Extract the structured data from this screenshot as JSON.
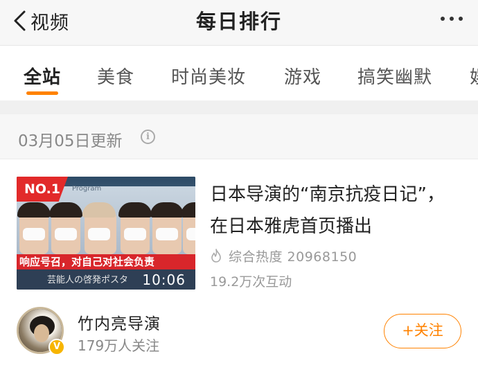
{
  "nav": {
    "back_label": "视频",
    "title": "每日排行"
  },
  "tabs": [
    {
      "label": "全站",
      "active": true
    },
    {
      "label": "美食",
      "active": false
    },
    {
      "label": "时尚美妆",
      "active": false
    },
    {
      "label": "游戏",
      "active": false
    },
    {
      "label": "搞笑幽默",
      "active": false
    },
    {
      "label": "娱",
      "active": false
    }
  ],
  "update": {
    "text": "03月05日更新",
    "info_icon": "info-icon"
  },
  "article": {
    "rank_badge": "NO.1",
    "headline": "日本导演的“南京抗疫日记”，在日本雅虎首页播出",
    "heat": "综合热度 20968150",
    "interactions": "19.2万次互动",
    "thumbnail": {
      "program_text": "Program",
      "banner_text": "响应号召，对自己对社会负责",
      "caption_text": "芸能人の啓発ポスタ",
      "duration": "10:06"
    }
  },
  "author": {
    "name": "竹内亮导演",
    "fans": "179万人关注",
    "verified_badge": "V",
    "follow_label": "+关注"
  },
  "colors": {
    "accent": "#ff8200",
    "rank_red": "#e22a2a",
    "muted_text": "#999999"
  }
}
